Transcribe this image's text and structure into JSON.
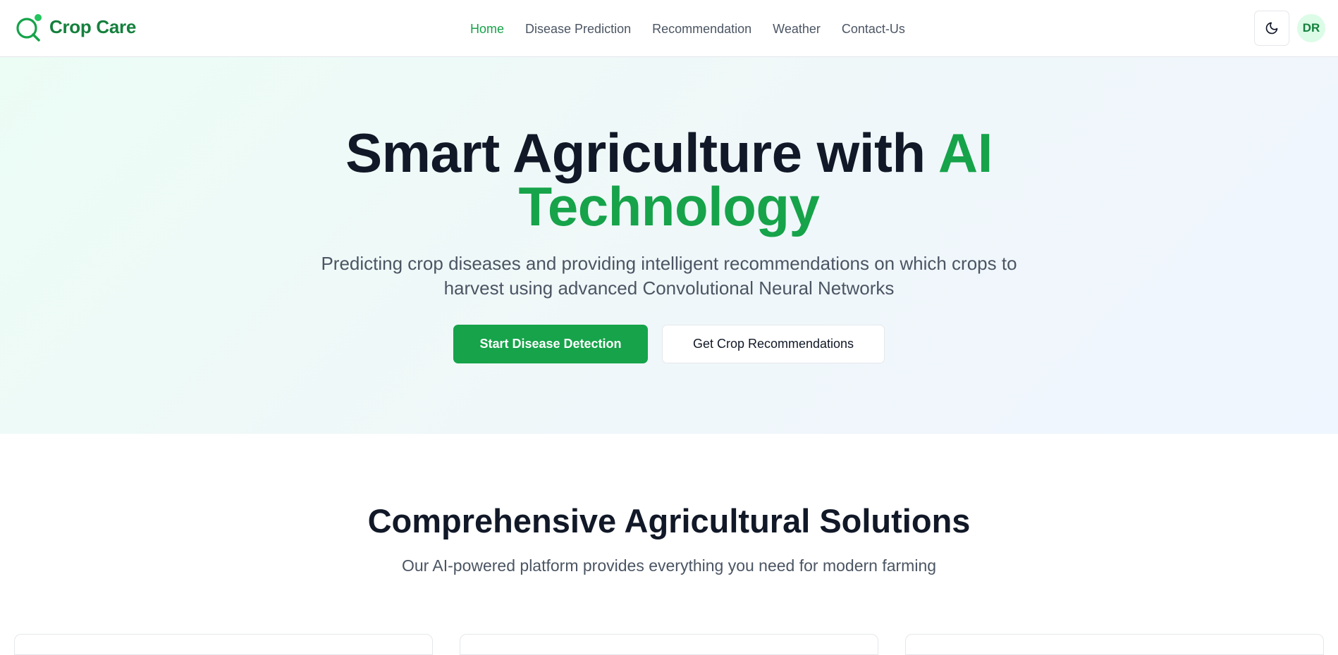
{
  "brand": {
    "name": "Crop Care"
  },
  "nav": {
    "items": [
      {
        "label": "Home",
        "active": true
      },
      {
        "label": "Disease Prediction",
        "active": false
      },
      {
        "label": "Recommendation",
        "active": false
      },
      {
        "label": "Weather",
        "active": false
      },
      {
        "label": "Contact-Us",
        "active": false
      }
    ]
  },
  "user": {
    "initials": "DR",
    "theme_icon": "moon-icon"
  },
  "hero": {
    "title_main": "Smart Agriculture with ",
    "title_accent_1": "AI",
    "title_accent_2": "Technology",
    "subtitle": "Predicting crop diseases and providing intelligent recommendations on which crops to harvest using advanced Convolutional Neural Networks",
    "primary_button": "Start Disease Detection",
    "secondary_button": "Get Crop Recommendations"
  },
  "features": {
    "title": "Comprehensive Agricultural Solutions",
    "subtitle": "Our AI-powered platform provides everything you need for modern farming"
  },
  "colors": {
    "primary": "#16a34a",
    "brand_text": "#15803d",
    "heading": "#111827",
    "muted_text": "#4b5563",
    "avatar_bg": "#dcfce7"
  }
}
